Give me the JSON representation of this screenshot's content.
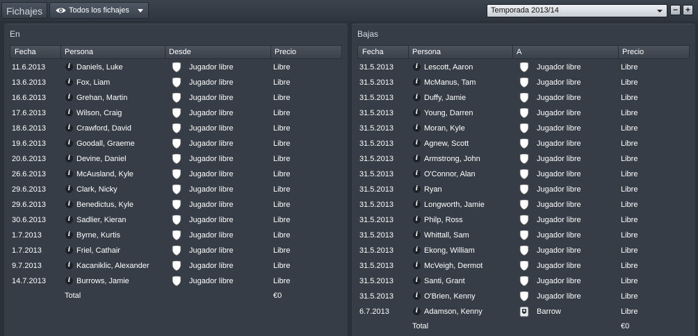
{
  "header": {
    "title": "Fichajes",
    "filter_label": "Todos los fichajes",
    "season": "Temporada 2013/14",
    "minus": "−",
    "plus": "+"
  },
  "colors": {
    "background": "#2b3139",
    "panel": "#363d46",
    "row_text": "#ffffff"
  },
  "left": {
    "title": "En",
    "columns": [
      "Fecha",
      "Persona",
      "Desde",
      "Precio"
    ],
    "rows": [
      {
        "date": "11.6.2013",
        "person": "Daniels, Luke",
        "club": "Jugador libre",
        "price": "Libre"
      },
      {
        "date": "13.6.2013",
        "person": "Fox, Liam",
        "club": "Jugador libre",
        "price": "Libre"
      },
      {
        "date": "16.6.2013",
        "person": "Grehan, Martin",
        "club": "Jugador libre",
        "price": "Libre"
      },
      {
        "date": "17.6.2013",
        "person": "Wilson, Craig",
        "club": "Jugador libre",
        "price": "Libre"
      },
      {
        "date": "18.6.2013",
        "person": "Crawford, David",
        "club": "Jugador libre",
        "price": "Libre"
      },
      {
        "date": "19.6.2013",
        "person": "Goodall, Graeme",
        "club": "Jugador libre",
        "price": "Libre"
      },
      {
        "date": "20.6.2013",
        "person": "Devine, Daniel",
        "club": "Jugador libre",
        "price": "Libre"
      },
      {
        "date": "26.6.2013",
        "person": "McAusland, Kyle",
        "club": "Jugador libre",
        "price": "Libre"
      },
      {
        "date": "29.6.2013",
        "person": "Clark, Nicky",
        "club": "Jugador libre",
        "price": "Libre"
      },
      {
        "date": "29.6.2013",
        "person": "Benedictus, Kyle",
        "club": "Jugador libre",
        "price": "Libre"
      },
      {
        "date": "30.6.2013",
        "person": "Sadlier, Kieran",
        "club": "Jugador libre",
        "price": "Libre"
      },
      {
        "date": "1.7.2013",
        "person": "Byrne, Kurtis",
        "club": "Jugador libre",
        "price": "Libre"
      },
      {
        "date": "1.7.2013",
        "person": "Friel, Cathair",
        "club": "Jugador libre",
        "price": "Libre"
      },
      {
        "date": "9.7.2013",
        "person": "Kacaniklic, Alexander",
        "club": "Jugador libre",
        "price": "Libre"
      },
      {
        "date": "14.7.2013",
        "person": "Burrows, Jamie",
        "club": "Jugador libre",
        "price": "Libre"
      }
    ],
    "total_label": "Total",
    "total_value": "€0"
  },
  "right": {
    "title": "Bajas",
    "columns": [
      "Fecha",
      "Persona",
      "A",
      "Precio"
    ],
    "rows": [
      {
        "date": "31.5.2013",
        "person": "Lescott, Aaron",
        "club": "Jugador libre",
        "price": "Libre"
      },
      {
        "date": "31.5.2013",
        "person": "McManus, Tam",
        "club": "Jugador libre",
        "price": "Libre"
      },
      {
        "date": "31.5.2013",
        "person": "Duffy, Jamie",
        "club": "Jugador libre",
        "price": "Libre"
      },
      {
        "date": "31.5.2013",
        "person": "Young, Darren",
        "club": "Jugador libre",
        "price": "Libre"
      },
      {
        "date": "31.5.2013",
        "person": "Moran, Kyle",
        "club": "Jugador libre",
        "price": "Libre"
      },
      {
        "date": "31.5.2013",
        "person": "Agnew, Scott",
        "club": "Jugador libre",
        "price": "Libre"
      },
      {
        "date": "31.5.2013",
        "person": "Armstrong, John",
        "club": "Jugador libre",
        "price": "Libre"
      },
      {
        "date": "31.5.2013",
        "person": "O'Connor, Alan",
        "club": "Jugador libre",
        "price": "Libre"
      },
      {
        "date": "31.5.2013",
        "person": "Ryan",
        "club": "Jugador libre",
        "price": "Libre"
      },
      {
        "date": "31.5.2013",
        "person": "Longworth, Jamie",
        "club": "Jugador libre",
        "price": "Libre"
      },
      {
        "date": "31.5.2013",
        "person": "Philp, Ross",
        "club": "Jugador libre",
        "price": "Libre"
      },
      {
        "date": "31.5.2013",
        "person": "Whittall, Sam",
        "club": "Jugador libre",
        "price": "Libre"
      },
      {
        "date": "31.5.2013",
        "person": "Ekong, William",
        "club": "Jugador libre",
        "price": "Libre"
      },
      {
        "date": "31.5.2013",
        "person": "McVeigh, Dermot",
        "club": "Jugador libre",
        "price": "Libre"
      },
      {
        "date": "31.5.2013",
        "person": "Santi, Grant",
        "club": "Jugador libre",
        "price": "Libre"
      },
      {
        "date": "31.5.2013",
        "person": "O'Brien, Kenny",
        "club": "Jugador libre",
        "price": "Libre"
      },
      {
        "date": "6.7.2013",
        "person": "Adamson, Kenny",
        "club": "Barrow",
        "price": "Libre",
        "crest": "barrow-crest-icon"
      }
    ],
    "total_label": "Total",
    "total_value": "€0"
  }
}
